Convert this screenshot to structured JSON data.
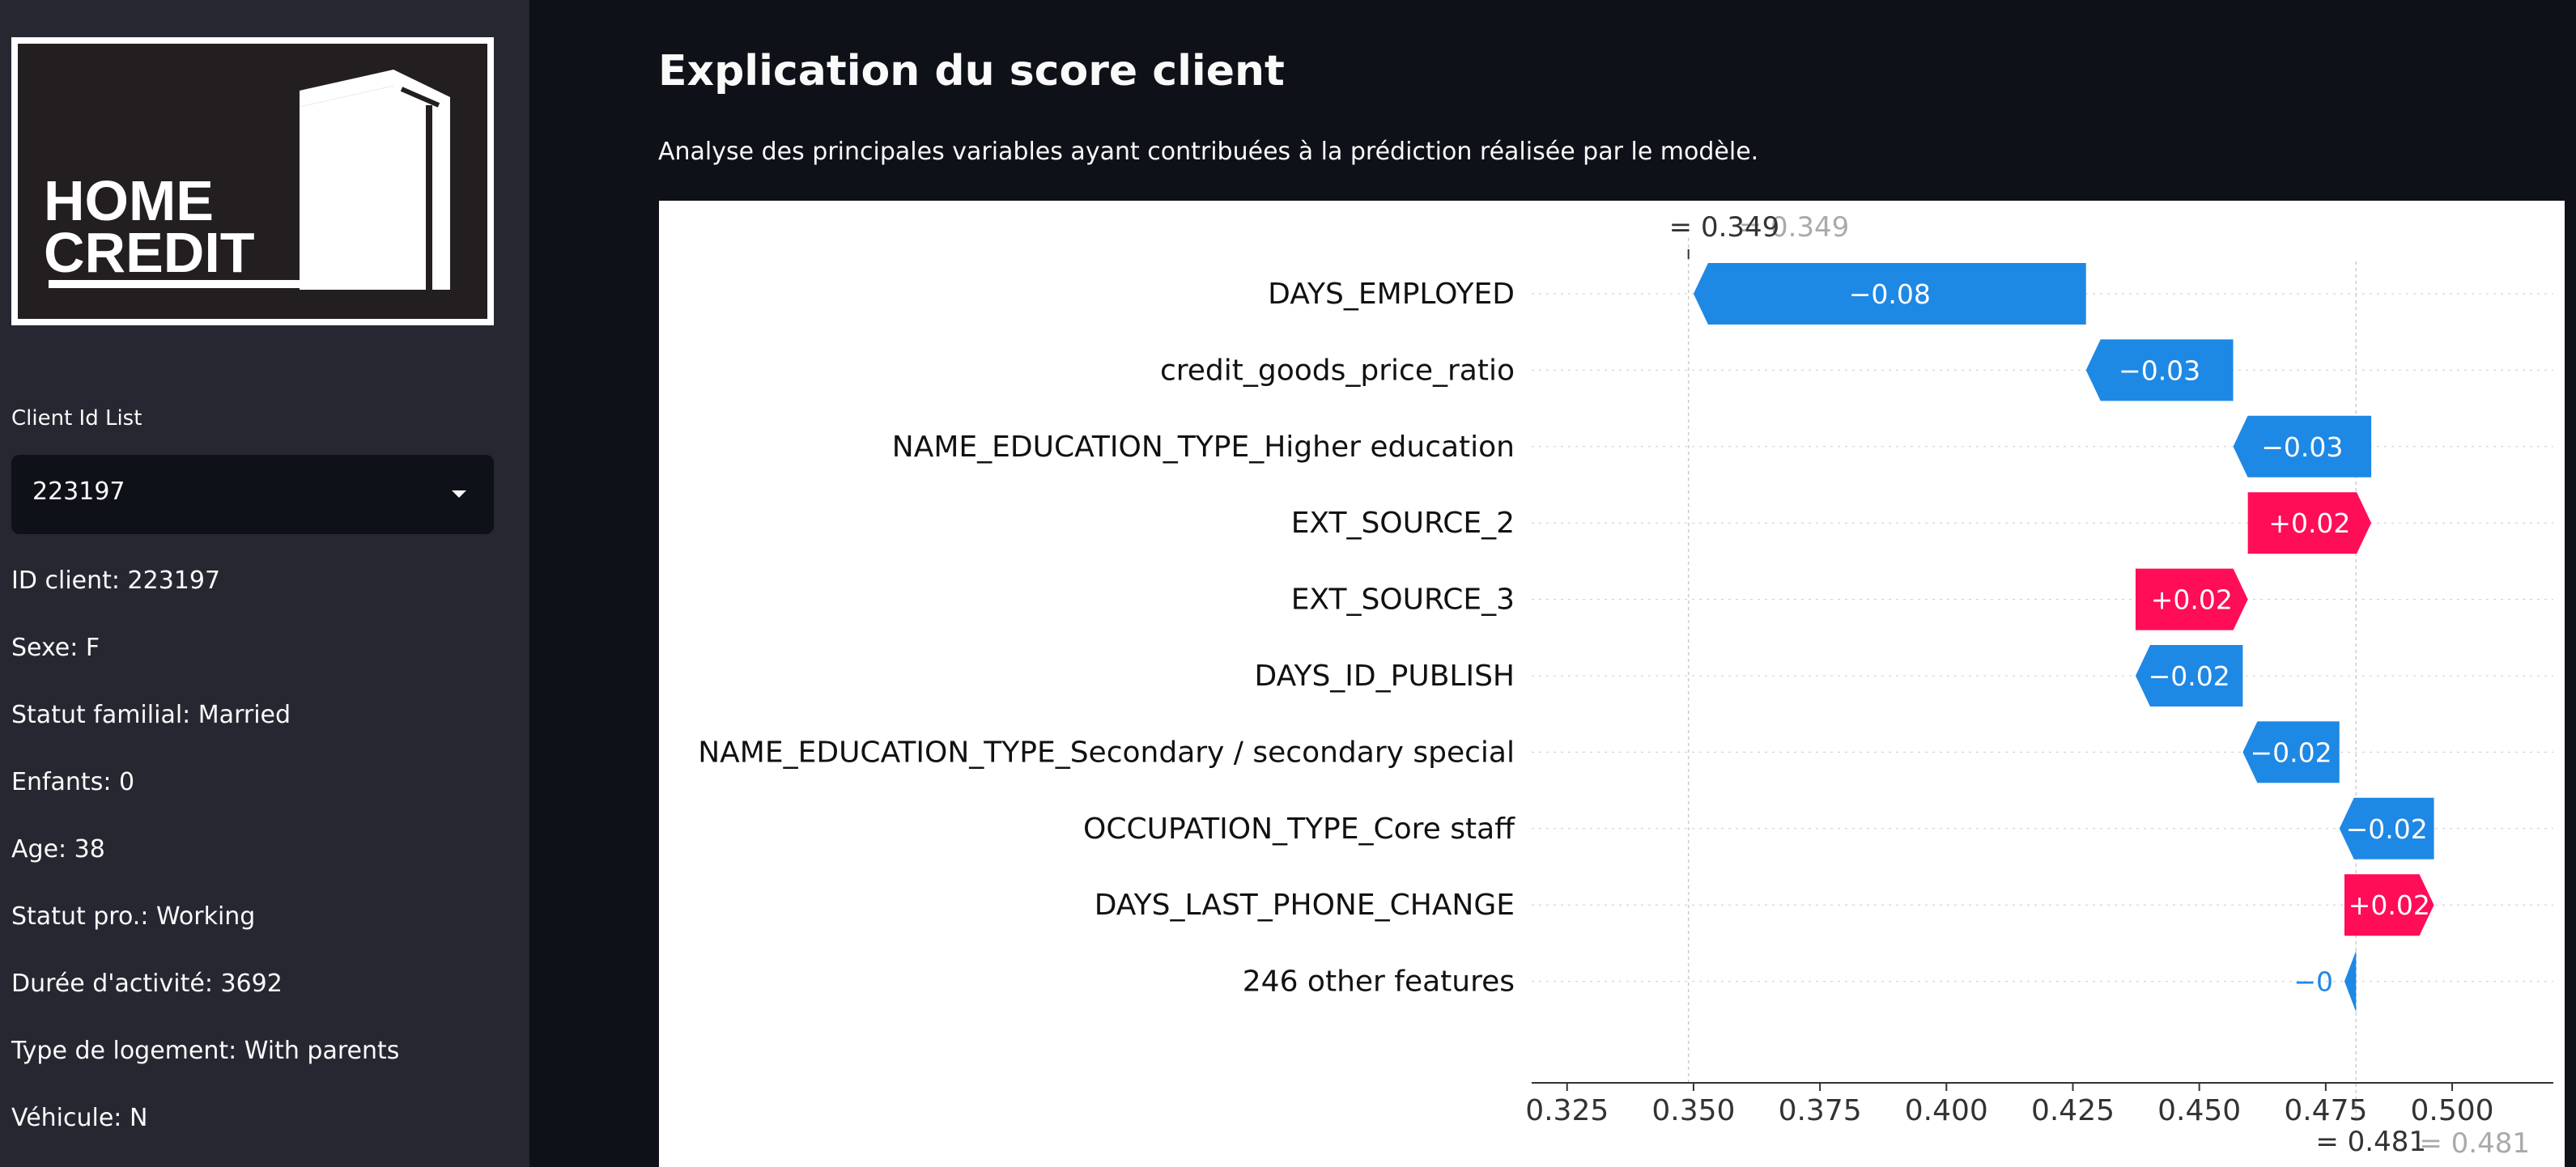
{
  "brand": {
    "logo_line1": "HOME",
    "logo_line2": "CREDIT"
  },
  "sidebar": {
    "select_label": "Client Id List",
    "selected_client": "223197",
    "info": [
      "ID client: 223197",
      "Sexe: F",
      "Statut familial: Married",
      "Enfants: 0",
      "Age: 38",
      "Statut pro.: Working",
      "Durée d'activité: 3692",
      "Type de logement: With parents",
      "Véhicule: N"
    ]
  },
  "main": {
    "title": "Explication du score client",
    "subtitle": "Analyse des principales variables ayant contribuées à la prédiction réalisée par le modèle."
  },
  "colors": {
    "positive": "#ff0d57",
    "negative": "#1e88e5",
    "background": "#0e1117",
    "sidebar": "#262730"
  },
  "chart_data": {
    "type": "waterfall",
    "base_value": 0.481,
    "final_value": 0.349,
    "base_label": "= 0.481",
    "final_label": "= 0.349",
    "base_label_ghost": "= 0.481",
    "final_label_ghost": "= 0.349",
    "xlim": [
      0.318,
      0.52
    ],
    "x_ticks": [
      0.325,
      0.35,
      0.375,
      0.4,
      0.425,
      0.45,
      0.475,
      0.5
    ],
    "x_tick_labels": [
      "0.325",
      "0.350",
      "0.375",
      "0.400",
      "0.425",
      "0.450",
      "0.475",
      "0.500"
    ],
    "features": [
      {
        "name": "DAYS_EMPLOYED",
        "start": 0.4276,
        "end": 0.35,
        "label": "−0.08"
      },
      {
        "name": "credit_goods_price_ratio",
        "start": 0.4567,
        "end": 0.4276,
        "label": "−0.03"
      },
      {
        "name": "NAME_EDUCATION_TYPE_Higher education",
        "start": 0.484,
        "end": 0.4567,
        "label": "−0.03"
      },
      {
        "name": "EXT_SOURCE_2",
        "start": 0.4596,
        "end": 0.484,
        "label": "+0.02"
      },
      {
        "name": "EXT_SOURCE_3",
        "start": 0.4374,
        "end": 0.4596,
        "label": "+0.02"
      },
      {
        "name": "DAYS_ID_PUBLISH",
        "start": 0.4586,
        "end": 0.4374,
        "label": "−0.02"
      },
      {
        "name": "NAME_EDUCATION_TYPE_Secondary / secondary special",
        "start": 0.4777,
        "end": 0.4586,
        "label": "−0.02"
      },
      {
        "name": "OCCUPATION_TYPE_Core staff",
        "start": 0.4964,
        "end": 0.4777,
        "label": "−0.02"
      },
      {
        "name": "DAYS_LAST_PHONE_CHANGE",
        "start": 0.4787,
        "end": 0.4964,
        "label": "+0.02"
      },
      {
        "name": "246 other features",
        "start": 0.481,
        "end": 0.4787,
        "label": "−0"
      }
    ]
  }
}
